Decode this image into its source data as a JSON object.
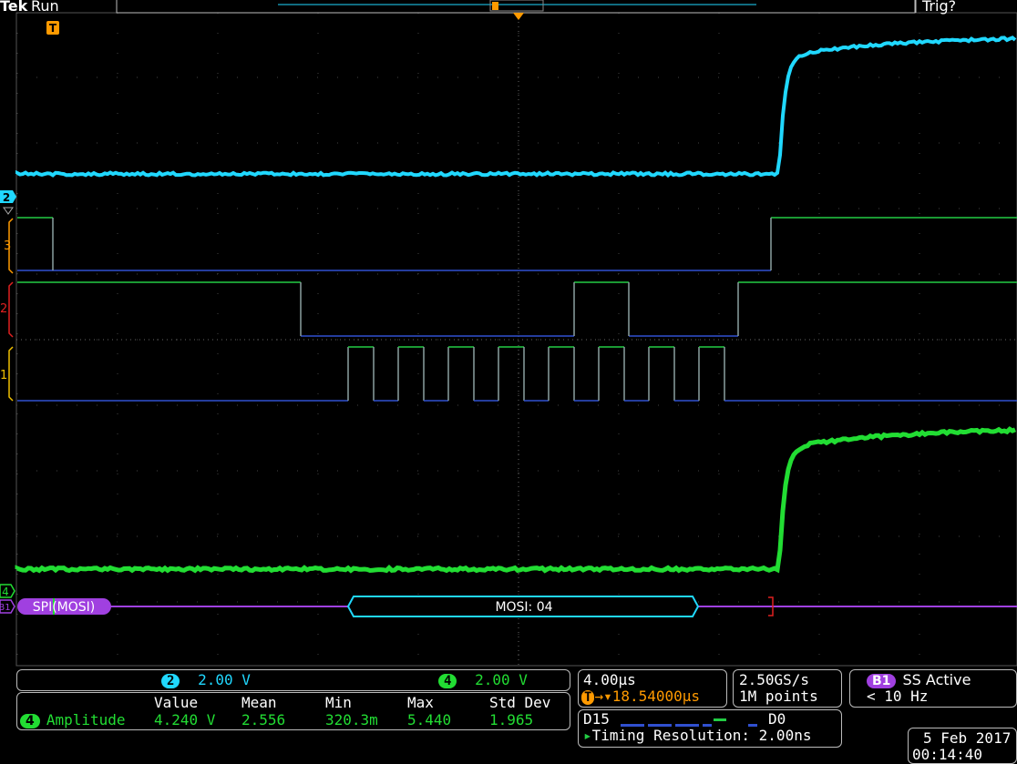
{
  "header": {
    "brand": "Tek",
    "run_state": "Run",
    "trigger_state": "Trig?"
  },
  "channels": {
    "ch1_marker": "1",
    "ch2_marker": "2",
    "ch3_marker": "3",
    "ch4_marker": "4",
    "b1_marker": "B1",
    "trigger_marker": "T"
  },
  "bus": {
    "label": "SPI(MOSI)",
    "packet": "MOSI: 04"
  },
  "scales": {
    "ch2_badge": "2",
    "ch2_scale": "2.00 V",
    "ch4_badge": "4",
    "ch4_scale": "2.00 V"
  },
  "measurements": {
    "headers": [
      "Value",
      "Mean",
      "Min",
      "Max",
      "Std Dev"
    ],
    "row": {
      "badge": "4",
      "name": "Amplitude",
      "values": [
        "4.240 V",
        "2.556",
        "320.3m",
        "5.440",
        "1.965"
      ]
    }
  },
  "horizontal": {
    "timebase": "4.00µs",
    "delay": "18.54000µs",
    "sample_rate": "2.50GS/s",
    "record_length": "1M points"
  },
  "bus_trigger": {
    "badge": "B1",
    "state": "SS Active",
    "freq": "< 10 Hz"
  },
  "digital": {
    "range_high": "D15",
    "range_low": "D0",
    "timing_resolution": "Timing Resolution: 2.00ns"
  },
  "datetime": {
    "date": "5 Feb  2017",
    "time": "00:14:40"
  },
  "colors": {
    "ch1": "#f0c000",
    "ch2": "#20d8ff",
    "ch3": "#ff9a00",
    "ch4": "#22dd33",
    "bus": "#a040e0",
    "digital": "#22cc44",
    "digital_low": "#3050d0"
  }
}
